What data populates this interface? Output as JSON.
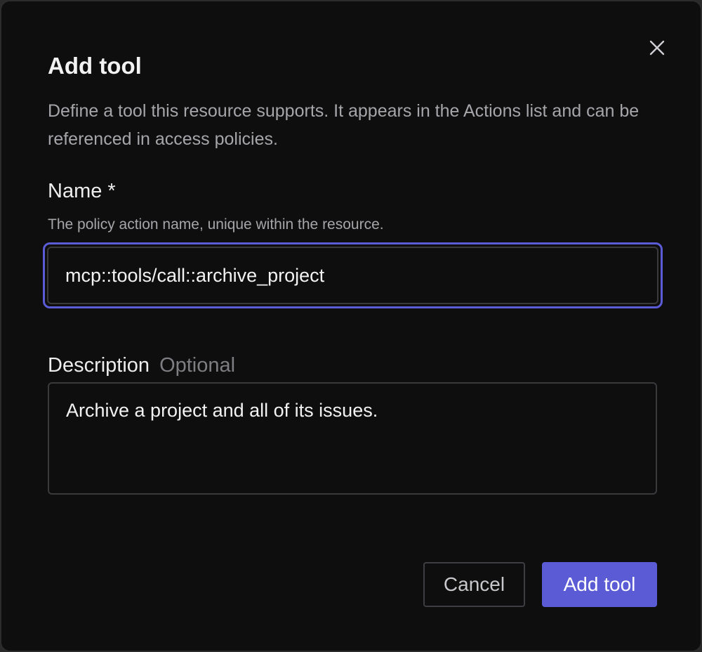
{
  "dialog": {
    "title": "Add tool",
    "subtitle": "Define a tool this resource supports. It appears in the Actions list and can be referenced in access policies.",
    "close_icon": "close-icon"
  },
  "name_field": {
    "label": "Name *",
    "hint": "The policy action name, unique within the resource.",
    "value": "mcp::tools/call::archive_project"
  },
  "description_field": {
    "label": "Description",
    "optional_label": "Optional",
    "value": "Archive a project and all of its issues."
  },
  "actions": {
    "cancel_label": "Cancel",
    "submit_label": "Add tool"
  },
  "colors": {
    "accent": "#5b5bd6",
    "background": "#0e0e0f",
    "text_muted": "#a6a6aa"
  }
}
